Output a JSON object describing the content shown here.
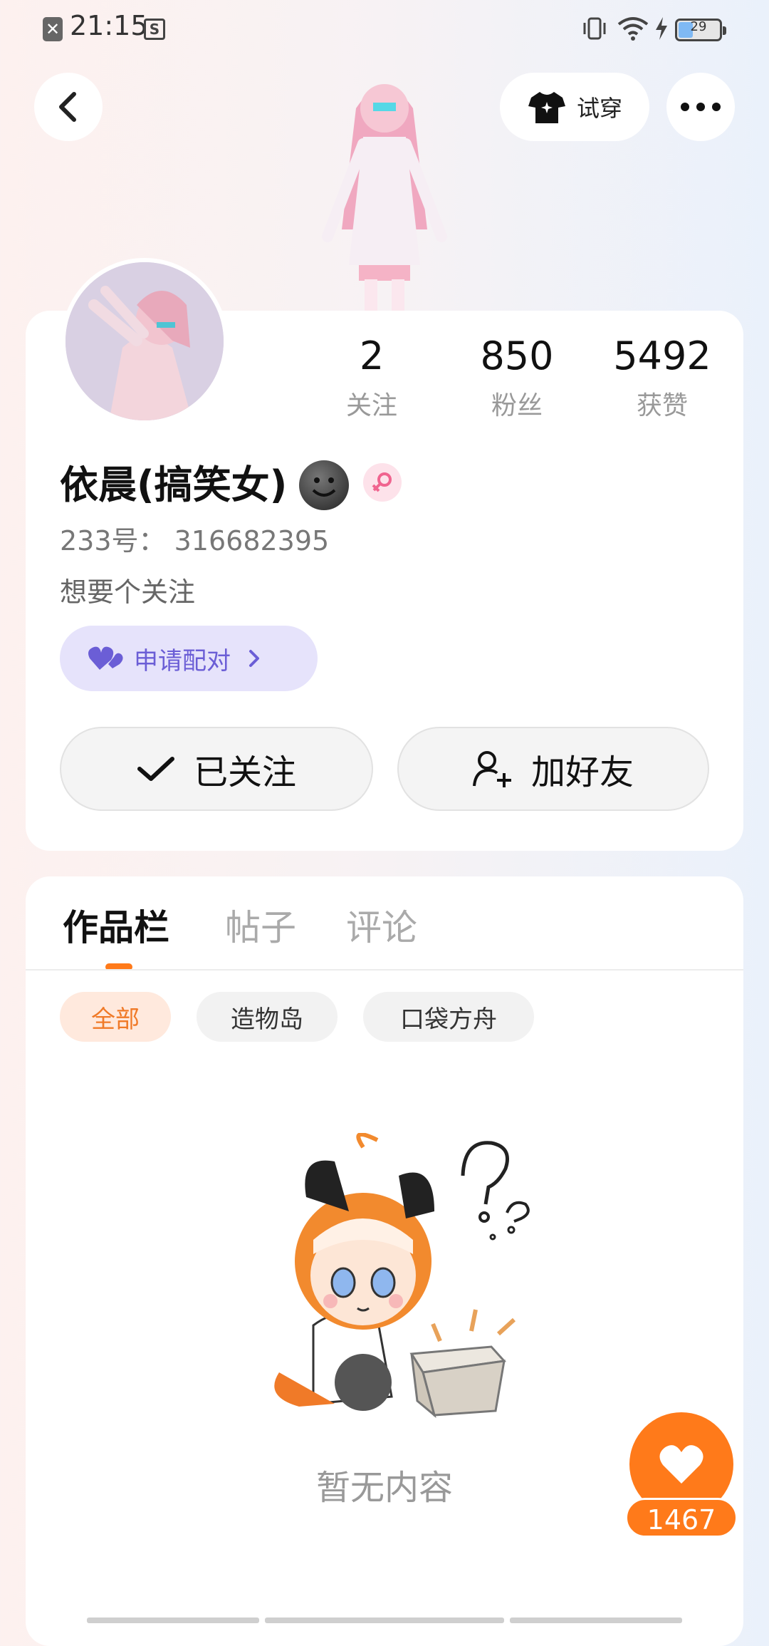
{
  "status_bar": {
    "time": "21:15",
    "battery": "29",
    "icons": [
      "close-box-icon",
      "screenshot-icon",
      "vibrate-icon",
      "wifi-icon",
      "charging-icon",
      "battery-icon"
    ]
  },
  "top_bar": {
    "back_icon": "chevron-left-icon",
    "try_on_label": "试穿",
    "more_icon": "more-dots-icon"
  },
  "profile": {
    "stats": [
      {
        "value": "2",
        "label": "关注"
      },
      {
        "value": "850",
        "label": "粉丝"
      },
      {
        "value": "5492",
        "label": "获赞"
      }
    ],
    "name": "依晨(搞笑女)",
    "gender": "female",
    "id_line": "233号： 316682395",
    "bio": "想要个关注",
    "pair_label": "申请配对",
    "follow_button": "已关注",
    "add_friend_button": "加好友"
  },
  "content": {
    "tabs": [
      {
        "label": "作品栏",
        "active": true
      },
      {
        "label": "帖子",
        "active": false
      },
      {
        "label": "评论",
        "active": false
      }
    ],
    "chips": [
      {
        "label": "全部",
        "active": true
      },
      {
        "label": "造物岛",
        "active": false
      },
      {
        "label": "口袋方舟",
        "active": false
      }
    ],
    "empty_text": "暂无内容"
  },
  "fab": {
    "like_count": "1467"
  },
  "colors": {
    "accent": "#ff7a1a",
    "pair_purple": "#6b5ed6",
    "pair_bg": "#e6e3fb"
  }
}
